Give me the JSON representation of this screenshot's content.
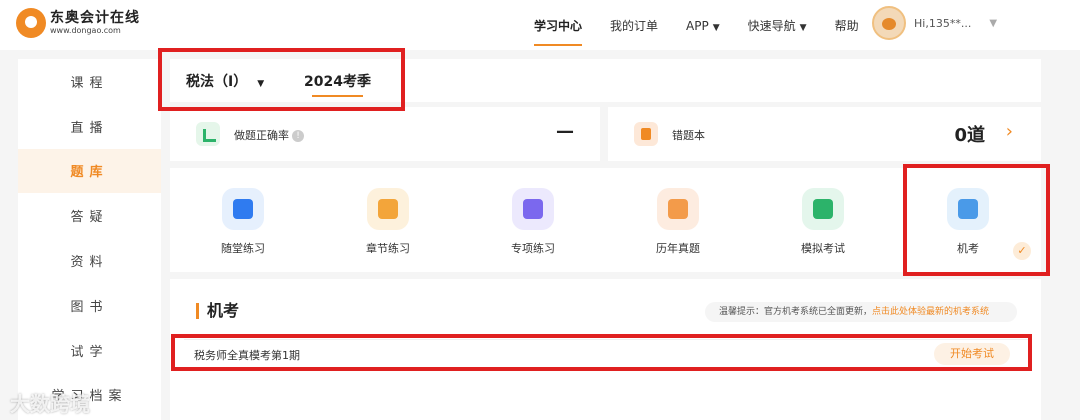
{
  "brand": {
    "name": "东奥会计在线",
    "url": "www.dongao.com"
  },
  "nav": [
    {
      "label": "学习中心"
    },
    {
      "label": "我的订单"
    },
    {
      "label": "APP"
    },
    {
      "label": "快速导航"
    },
    {
      "label": "帮助"
    }
  ],
  "user": {
    "name": "Hi,135**..."
  },
  "sidebar": [
    {
      "label": "课程"
    },
    {
      "label": "直播"
    },
    {
      "label": "题库"
    },
    {
      "label": "答疑"
    },
    {
      "label": "资料"
    },
    {
      "label": "图书"
    },
    {
      "label": "试学"
    },
    {
      "label": "学习档案"
    }
  ],
  "subject": {
    "name": "税法（Ⅰ）",
    "season": "2024考季"
  },
  "stats": {
    "accuracy_label": "做题正确率",
    "accuracy_value": "—",
    "wrong_label": "错题本",
    "wrong_value": "0道"
  },
  "modes": [
    {
      "label": "随堂练习",
      "icon": "laptop-icon"
    },
    {
      "label": "章节练习",
      "icon": "book-icon"
    },
    {
      "label": "专项练习",
      "icon": "document-icon"
    },
    {
      "label": "历年真题",
      "icon": "exam-paper-icon"
    },
    {
      "label": "模拟考试",
      "icon": "calendar-icon"
    },
    {
      "label": "机考",
      "icon": "computer-exam-icon"
    }
  ],
  "exam": {
    "title": "机考",
    "tip_prefix": "温馨提示：官方机考系统已全面更新，",
    "tip_link": "点击此处体验最新的机考系统",
    "rows": [
      {
        "name": "税务师全真模考第1期",
        "action": "开始考试"
      }
    ]
  },
  "colors": {
    "accent": "#f08a24",
    "highlight": "#e02020"
  },
  "watermark": "大数跨境"
}
